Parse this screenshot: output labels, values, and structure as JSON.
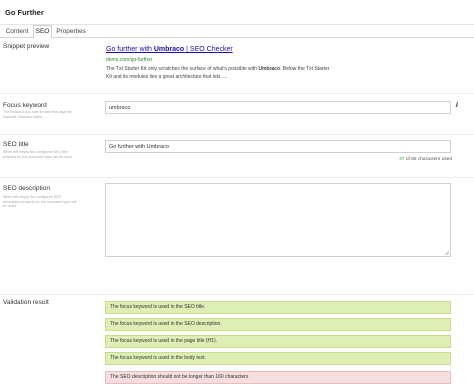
{
  "document": {
    "name": "Go Further"
  },
  "tabs": [
    {
      "label": "Content",
      "active": false
    },
    {
      "label": "SEO",
      "active": true
    },
    {
      "label": "Properties",
      "active": false
    }
  ],
  "snippet": {
    "label": "Snippet preview",
    "title_pre": "Go further with ",
    "title_keyword": "Umbraco",
    "title_post": " | SEO Checker",
    "url": "demo.com/go-further",
    "description": "The Txt Starter Kit only scratches the surface of what's possible with Umbraco. Below the Txt Starter Kit and its modules lies a great architecture that lets ...",
    "description_pre": "The Txt Starter Kit only scratches the surface of what's possible with ",
    "description_keyword": "Umbraco",
    "description_post": ". Below the Txt Starter Kit and its modules lies a great architecture that lets ...."
  },
  "focus_keyword": {
    "label": "Focus keyword",
    "description": "The keyword you want to rank this page for, example Umbraco editor",
    "value": "umbraco",
    "icon": "key-icon"
  },
  "seo_title": {
    "label": "SEO title",
    "description": "When left empty the configured SEO title property for the document type will be used",
    "value": "Go further with Umbraco",
    "counter_used": "37",
    "counter_rest": " of 65 characters used"
  },
  "seo_description": {
    "label": "SEO description",
    "description": "When left empty the configured SEO description property for the document type will be used",
    "value": "",
    "icon": "resize-handle-icon"
  },
  "validation": {
    "label": "Validation result",
    "results": [
      {
        "text": "The focus keyword is used in the SEO title.",
        "status": "ok"
      },
      {
        "text": "The focus keyword is used in the SEO description.",
        "status": "ok"
      },
      {
        "text": "The focus keyword is used in the page title (H1).",
        "status": "ok"
      },
      {
        "text": "The focus keyword is used in the body text.",
        "status": "ok"
      },
      {
        "text": "The SEO description should not be longer than 160 characters",
        "status": "bad"
      }
    ]
  },
  "colors": {
    "link": "#1a0dab",
    "url": "#2a8a2a",
    "counter_ok": "#2e9f2e",
    "result_ok": "#dfeeb4",
    "result_bad": "#f6dede"
  }
}
